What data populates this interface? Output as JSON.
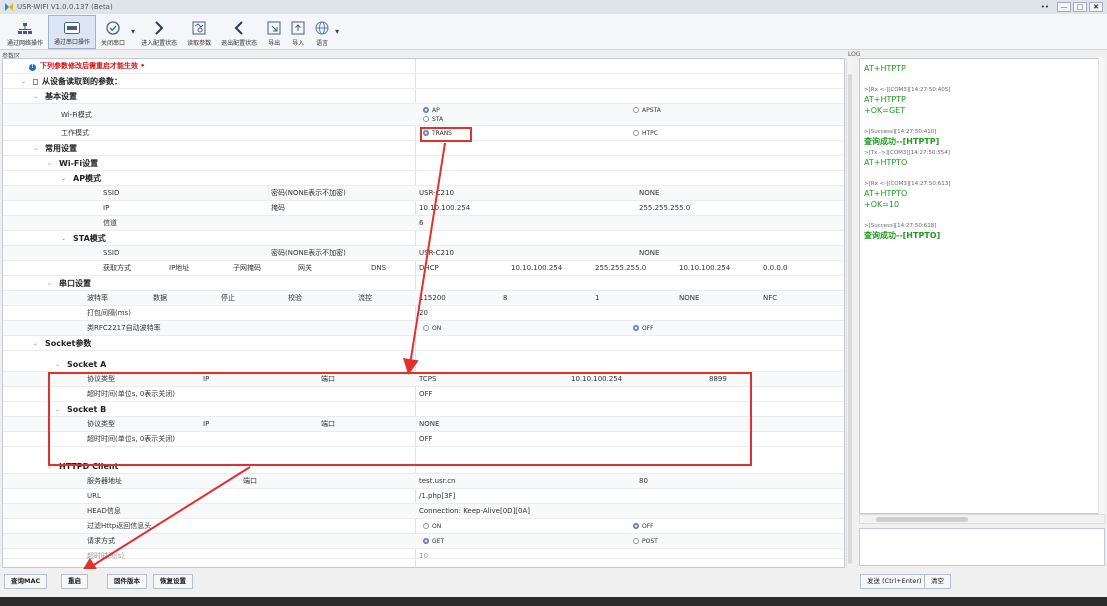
{
  "window": {
    "title": "USR-WIFI V1.0.0.137 (Beta)",
    "controls": [
      "—",
      "□",
      "✖"
    ],
    "extra": "••"
  },
  "toolbar": {
    "items": [
      {
        "label": "通过网络操作",
        "icon": "network-icon"
      },
      {
        "label": "通过串口操作",
        "icon": "serial-icon"
      },
      {
        "label": "关闭串口",
        "icon": "close-port-icon"
      },
      {
        "label": "进入配置状态",
        "icon": "enter-config-icon"
      },
      {
        "label": "读取参数",
        "icon": "read-params-icon"
      },
      {
        "label": "退出配置状态",
        "icon": "exit-config-icon"
      },
      {
        "label": "导出",
        "icon": "export-icon"
      },
      {
        "label": "导入",
        "icon": "import-icon"
      },
      {
        "label": "语言",
        "icon": "language-icon"
      }
    ],
    "arrow": "▾"
  },
  "params_label": "参数区",
  "log_label": "LOG",
  "notice": "下列参数修改后需重启才能生效 •",
  "tree": {
    "root": "从设备读取到的参数：",
    "basic": "基本设置",
    "wifi_mode_label": "Wi-Fi模式",
    "wifi_mode_options": [
      "AP",
      "STA",
      "APSTA"
    ],
    "work_mode_label": "工作模式",
    "work_mode_options": [
      "TRANS",
      "HTPC"
    ],
    "common": "常用设置",
    "wifi_settings": "Wi-Fi设置",
    "ap_mode": "AP模式",
    "ap": {
      "ssid_label": "SSID",
      "pwd_label": "密码(NONE表示不加密)",
      "ssid": "USR-C210",
      "pwd": "NONE",
      "ip_label": "IP",
      "mask_label": "掩码",
      "ip": "10.10.100.254",
      "mask": "255.255.255.0",
      "channel_label": "信道",
      "channel": "6"
    },
    "sta_mode": "STA模式",
    "sta": {
      "ssid_label": "SSID",
      "pwd_label": "密码(NONE表示不加密)",
      "ssid": "USR-C210",
      "pwd": "NONE",
      "get_label": "获取方式",
      "ip_label": "IP地址",
      "mask_label": "子网掩码",
      "gw_label": "网关",
      "dns_label": "DNS",
      "get": "DHCP",
      "ip": "10.10.100.254",
      "mask": "255.255.255.0",
      "gw": "10.10.100.254",
      "dns": "0.0.0.0"
    },
    "serial": "串口设置",
    "uart": {
      "baud_label": "波特率",
      "data_label": "数据",
      "stop_label": "停止",
      "parity_label": "校验",
      "flow_label": "流控",
      "baud": "115200",
      "data": "8",
      "stop": "1",
      "parity": "NONE",
      "flow": "NFC",
      "pack_label": "打包间隔(ms)",
      "pack": "20",
      "rfc_label": "类RFC2217自动波特率",
      "rfc_on": "ON",
      "rfc_off": "OFF"
    },
    "socket": "Socket参数",
    "socket_a": {
      "title": "Socket A",
      "proto_label": "协议类型",
      "ip_label": "IP",
      "port_label": "端口",
      "proto": "TCPS",
      "ip": "10.10.100.254",
      "port": "8899",
      "timeout_label": "超时时间(单位s, 0表示关闭)",
      "timeout": "OFF"
    },
    "socket_b": {
      "title": "Socket B",
      "proto_label": "协议类型",
      "ip_label": "IP",
      "port_label": "端口",
      "proto": "NONE",
      "ip": "",
      "port": "",
      "timeout_label": "超时时间(单位s, 0表示关闭)",
      "timeout": "OFF"
    },
    "httpd": "HTTPD Client",
    "http": {
      "server_label": "服务器地址",
      "port_label": "端口",
      "server": "test.usr.cn",
      "port": "80",
      "url_label": "URL",
      "url": "/1.php[3F]",
      "head_label": "HEAD信息",
      "head": "Connection: Keep-Alive[0D][0A]",
      "filter_label": "过滤Http返回信息头",
      "filter_on": "ON",
      "filter_off": "OFF",
      "method_label": "请求方式",
      "method_get": "GET",
      "method_post": "POST",
      "partial_label": "超时时间(s)",
      "partial_val": "10"
    }
  },
  "log": {
    "entries": [
      {
        "meta": "",
        "lines": [
          "AT+HTPTP"
        ],
        "style": "green"
      },
      {
        "meta": ">[Rx <-][COM3][14:27:50:405]",
        "lines": [
          "AT+HTPTP",
          "+OK=GET"
        ],
        "style": "green"
      },
      {
        "meta": ">[Success][14:27:50:410]",
        "lines": [
          "查询成功--[HTPTP]"
        ],
        "style": "bold"
      },
      {
        "meta": ">[Tx ->][COM3][14:27:50:554]",
        "lines": [
          "AT+HTPTO"
        ],
        "style": "green"
      },
      {
        "meta": ">[Rx <-][COM3][14:27:50:613]",
        "lines": [
          "AT+HTPTO",
          "+OK=10"
        ],
        "style": "green"
      },
      {
        "meta": ">[Success][14:27:50:618]",
        "lines": [
          "查询成功--[HTPTO]"
        ],
        "style": "bold"
      }
    ]
  },
  "bottom": {
    "query_mac": "查询MAC",
    "restart": "重启",
    "firmware": "固件版本",
    "restore": "恢复设置",
    "send": "发送 (Ctrl+Enter)",
    "clear": "清空"
  },
  "colors": {
    "accent_red": "#e03030",
    "log_green": "#1f9a1f",
    "notice_red": "#d31010"
  }
}
